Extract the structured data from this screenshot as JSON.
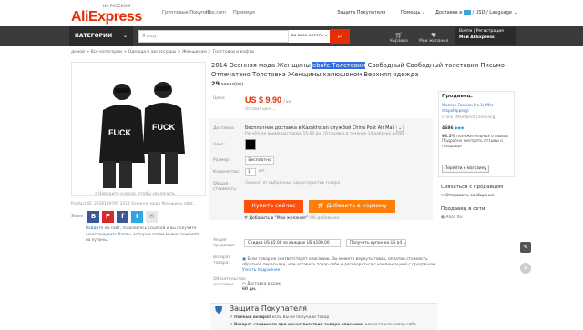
{
  "header": {
    "logo": "AliExpress",
    "logo_sub": "НА РУССКОМ",
    "links": [
      "Групповые Покупки",
      "iTao.com",
      "Премиум"
    ],
    "protection": "Защита Покупателя",
    "help": "Помощь",
    "shipping": "Доставка в",
    "currency": "USD",
    "language": "Language"
  },
  "nav": {
    "categories": "КАТЕГОРИИ",
    "search_placeholder": "Я ищу",
    "search_category": "во всех катего",
    "cart": "Корзина",
    "wishlist": "Мои желания",
    "account_line1": "Войти | Регистрация",
    "account_line2": "Мой AliExpress"
  },
  "breadcrumb": "домой > Все категории > Одежда и аксессуары > Женщинам > Толстовки и кофты",
  "product": {
    "title_pre": "2014 Осенняя мода Женщины ",
    "title_hl": "ebafe Толстовки",
    "title_post": " Свободный Свободный толстовки Письмо Отпечатано Толстовка Женщины капюшоном Верхняя одежда",
    "orders_count": "29",
    "orders_label": "заказ(ов)",
    "price_label": "Цена:",
    "price": "US $ 9.90",
    "price_unit": "/ шт.",
    "price_sub": "Оптовая цена",
    "ship_label": "Доставка:",
    "ship_text": "Бесплатная доставка в Kazakhstan службой China Post Air Mail",
    "ship_sub": "Расчётное время доставки: 15-60 дн. (Отправка в течение 14 рабочих дней)",
    "color_label": "Цвет:",
    "size_label": "Размер:",
    "size_value": "Бесплатно",
    "qty_label": "Количество:",
    "qty_value": "1",
    "qty_unit": "шт.",
    "total_label": "Общая стоимость:",
    "total_text": "Зависит от выбранных характеристик товара",
    "buy_now": "Купить сейчас",
    "add_cart": "Добавить в корзину",
    "wish": "Добавить в \"Мои желания\"",
    "wish_count": "(90 добавили)",
    "zoom_hint": "Наведите курсор, чтобы увеличить",
    "product_id": "Product ID: 2028149795 2014 Осенняя мода Женщины ebaf..."
  },
  "share": {
    "label": "Share",
    "text_lead": "Войдите",
    "text_mid": " на сайт, поделитесь ссылкой и вы получите шанс ",
    "text_link": "получить баллы",
    "text_tail": ", которые затем можно поменять на купоны."
  },
  "promo": {
    "label1": "Акция продавца:",
    "coupon1": "Скидка US $5.00 за каждые US $100.00",
    "coupon2": "Получить купон на US $4",
    "label2": "Возврат товара:",
    "return_text": "Если товар не соответствует описанию, Вы можете вернуть товар, оплатив стоимость обратной пересылки, или оставить товар себе и договориться с компенсацией с продавцом.",
    "return_link": "Узнать подробнее",
    "label3": "Обязательство доставки:",
    "delivery_text": "Доставка в срок",
    "delivery_days": "60 дн."
  },
  "protection": {
    "title": "Защита Покупателя",
    "line1_b": "Полный возврат",
    "line1": " если Вы не получили товар",
    "line2_b": "Возврат стоимости при несоответствии товара описанию",
    "line2": " или оставьте товар себе"
  },
  "seller": {
    "title": "Продавец:",
    "name": "Women Fashion No.1(offer dropshipping)",
    "location": "China (Mainland) (Zhejiang)",
    "score": "4686",
    "positive_pct": "96.5%",
    "positive_label": "положительных отзывов",
    "reviews_link": "Подробно смотреть отзывы о продавце",
    "store_btn": "Перейти к магазину",
    "contact_title": "Связаться с продавцом",
    "contact_link": "Отправить сообщение",
    "network_title": "Продавец в сети",
    "network_name": "Alice Xu"
  }
}
